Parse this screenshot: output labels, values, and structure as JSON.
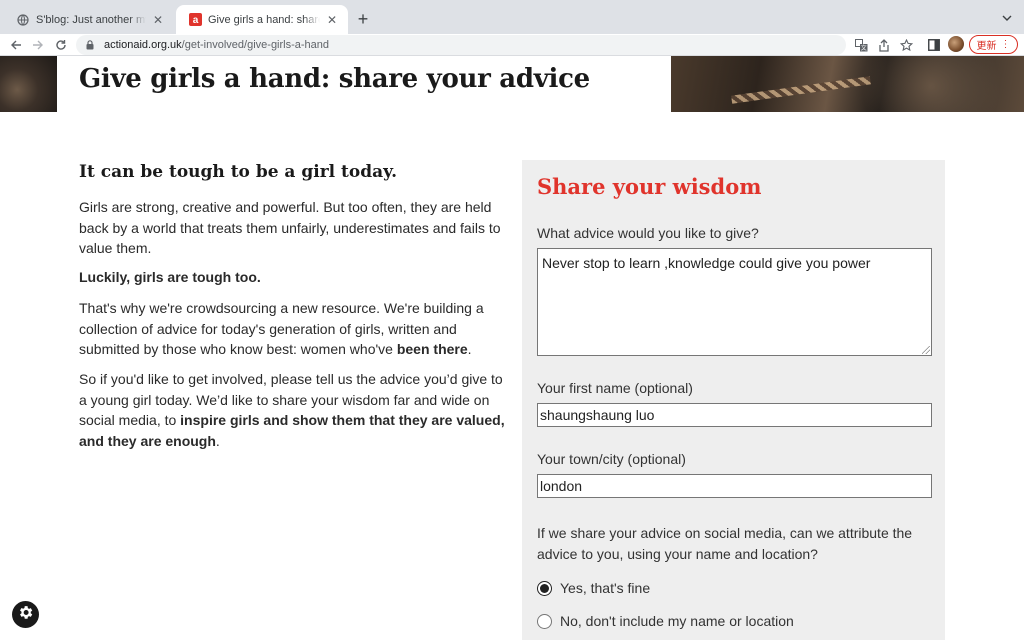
{
  "browser": {
    "tabs": [
      {
        "title": "S'blog: Just another myblog.ac",
        "favicon": "globe-icon",
        "active": false
      },
      {
        "title": "Give girls a hand: share your ac",
        "favicon": "actionaid-icon",
        "active": true
      }
    ],
    "url_host": "actionaid.org.uk",
    "url_path": "/get-involved/give-girls-a-hand",
    "update_label": "更新"
  },
  "page": {
    "title": "Give girls a hand: share your advice",
    "intro_heading": "It can be tough to be a girl today.",
    "p1": "Girls are strong, creative and powerful. But too often, they are held back by a world that treats them unfairly, underestimates and fails to value them.",
    "p2": "Luckily, girls are tough too.",
    "p3_a": "That's why we're crowdsourcing a new resource. We're building a collection of advice for today's generation of girls, written and submitted by those who know best: women who've ",
    "p3_b": "been there",
    "p3_c": ".",
    "p4_a": "So if you'd like to get involved, please tell us the advice you’d give to a young girl today. We’d like to share your wisdom far and wide on social media, to ",
    "p4_b": "inspire girls and show them that they are valued, and they are enough",
    "p4_c": "."
  },
  "form": {
    "title": "Share your wisdom",
    "advice_label": "What advice would you like to give?",
    "advice_value": "Never stop to learn ,knowledge could give you power",
    "name_label": "Your first name (optional)",
    "name_value": "shaungshaung luo",
    "town_label": "Your town/city (optional)",
    "town_value": "london",
    "attribution_question": "If we share your advice on social media, can we attribute the advice to you, using your name and location?",
    "options": [
      {
        "label": "Yes, that's fine",
        "selected": true
      },
      {
        "label": "No, don't include my name or location",
        "selected": false
      }
    ]
  },
  "colors": {
    "accent": "#e0342c",
    "panel_bg": "#eeeeee"
  }
}
